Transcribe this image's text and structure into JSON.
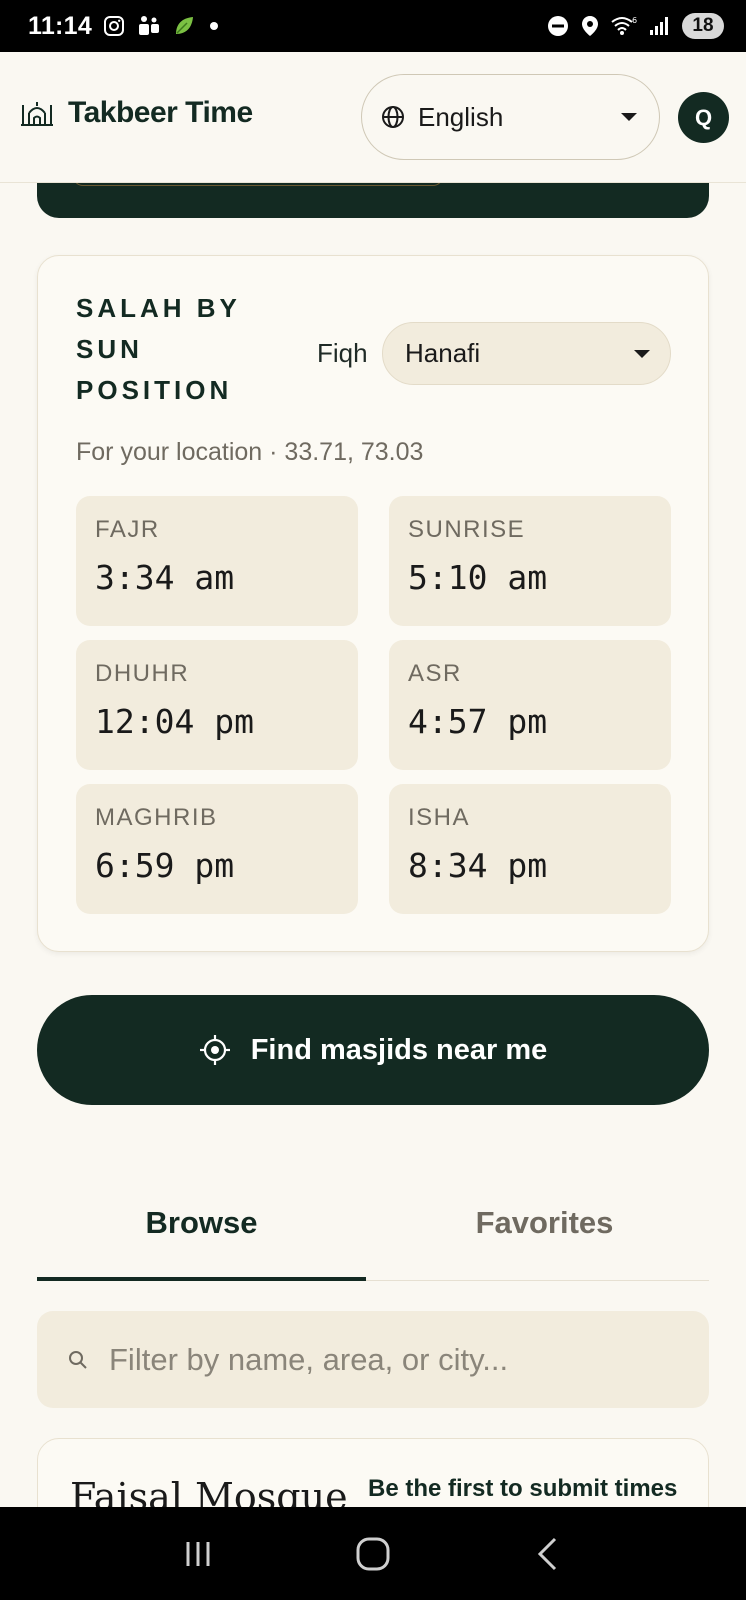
{
  "status_bar": {
    "time": "11:14",
    "battery": "18",
    "left_icons": [
      "instagram-icon",
      "teams-icon",
      "leaf-icon",
      "dot-icon"
    ],
    "right_icons": [
      "dnd-icon",
      "location-icon",
      "wifi-icon",
      "signal-icon"
    ]
  },
  "header": {
    "app_title": "Takbeer Time",
    "language": "English",
    "avatar_initial": "Q"
  },
  "salah_card": {
    "title": "SALAH BY SUN POSITION",
    "fiqh_label": "Fiqh",
    "fiqh_value": "Hanafi",
    "location": "For your location · 33.71, 73.03",
    "times": [
      {
        "name": "FAJR",
        "time": "3:34 am"
      },
      {
        "name": "SUNRISE",
        "time": "5:10 am"
      },
      {
        "name": "DHUHR",
        "time": "12:04 pm"
      },
      {
        "name": "ASR",
        "time": "4:57 pm"
      },
      {
        "name": "MAGHRIB",
        "time": "6:59 pm"
      },
      {
        "name": "ISHA",
        "time": "8:34 pm"
      }
    ]
  },
  "find_button": {
    "label": "Find masjids near me"
  },
  "tabs": {
    "browse": "Browse",
    "favorites": "Favorites",
    "active": "Browse"
  },
  "search": {
    "placeholder": "Filter by name, area, or city..."
  },
  "masjids": [
    {
      "name": "Faisal Mosque",
      "status": "Be the first to submit times"
    }
  ],
  "colors": {
    "primary_dark": "#132a22",
    "background": "#faf8f2",
    "tile": "#f2ecdd"
  }
}
